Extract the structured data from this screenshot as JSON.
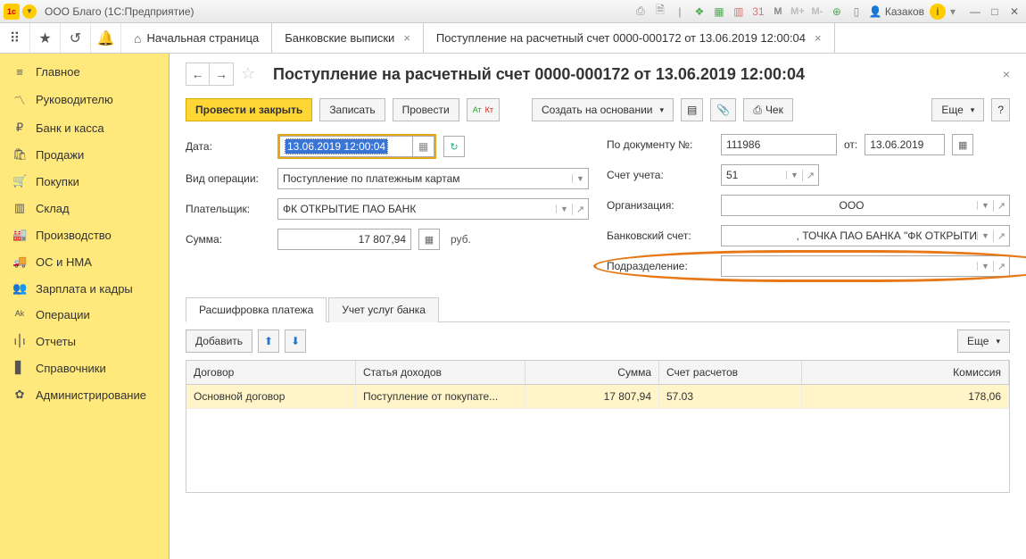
{
  "titlebar": {
    "app_title": "ООО Благо  (1С:Предприятие)",
    "user": "Казаков"
  },
  "top_tabs": {
    "home": "Начальная страница",
    "t1": "Банковские выписки",
    "t2": "Поступление на расчетный счет 0000-000172 от 13.06.2019 12:00:04"
  },
  "sidebar": {
    "items": [
      {
        "label": "Главное"
      },
      {
        "label": "Руководителю"
      },
      {
        "label": "Банк и касса"
      },
      {
        "label": "Продажи"
      },
      {
        "label": "Покупки"
      },
      {
        "label": "Склад"
      },
      {
        "label": "Производство"
      },
      {
        "label": "ОС и НМА"
      },
      {
        "label": "Зарплата и кадры"
      },
      {
        "label": "Операции"
      },
      {
        "label": "Отчеты"
      },
      {
        "label": "Справочники"
      },
      {
        "label": "Администрирование"
      }
    ]
  },
  "page": {
    "title": "Поступление на расчетный счет 0000-000172 от 13.06.2019 12:00:04"
  },
  "actions": {
    "post_close": "Провести и закрыть",
    "save": "Записать",
    "post": "Провести",
    "create_based": "Создать на основании",
    "check": "Чек",
    "more": "Еще"
  },
  "form": {
    "date_label": "Дата:",
    "date_value": "13.06.2019 12:00:04",
    "op_label": "Вид операции:",
    "op_value": "Поступление по платежным картам",
    "payer_label": "Плательщик:",
    "payer_value": "ФК ОТКРЫТИЕ ПАО БАНК",
    "sum_label": "Сумма:",
    "sum_value": "17 807,94",
    "sum_unit": "руб.",
    "docnum_label": "По документу №:",
    "docnum_value": "111986",
    "docnum_from": "от:",
    "docnum_date": "13.06.2019",
    "account_label": "Счет учета:",
    "account_value": "51",
    "org_label": "Организация:",
    "org_value": "ООО",
    "bank_label": "Банковский счет:",
    "bank_value": ", ТОЧКА ПАО БАНКА \"ФК ОТКРЫТИ",
    "division_label": "Подразделение:",
    "division_value": ""
  },
  "subtabs": {
    "t1": "Расшифровка платежа",
    "t2": "Учет услуг банка"
  },
  "subtoolbar": {
    "add": "Добавить",
    "more": "Еще"
  },
  "table": {
    "headers": {
      "c1": "Договор",
      "c2": "Статья доходов",
      "c3": "Сумма",
      "c4": "Счет расчетов",
      "c5": "Комиссия"
    },
    "row": {
      "c1": "Основной договор",
      "c2": "Поступление от покупате...",
      "c3": "17 807,94",
      "c4": "57.03",
      "c5": "178,06"
    }
  }
}
